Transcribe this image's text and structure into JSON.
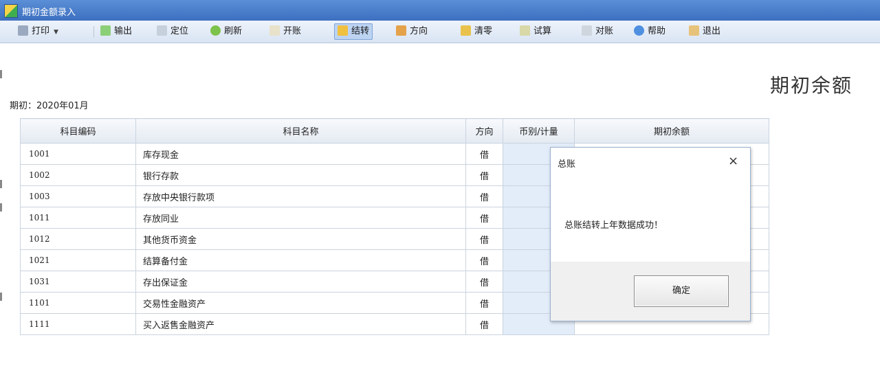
{
  "window": {
    "title": "期初金额录入"
  },
  "toolbar": {
    "print": "打印",
    "output": "输出",
    "locate": "定位",
    "refresh": "刷新",
    "open": "开账",
    "carry": "结转",
    "direction": "方向",
    "clear": "清零",
    "trial": "试算",
    "reconcile": "对账",
    "help": "帮助",
    "exit": "退出"
  },
  "page": {
    "title": "期初余额",
    "period_label": "期初：2020年01月"
  },
  "table": {
    "columns": [
      "科目编码",
      "科目名称",
      "方向",
      "币别/计量",
      "期初余额"
    ],
    "rows": [
      {
        "code": "1001",
        "name": "库存现金",
        "dir": "借"
      },
      {
        "code": "1002",
        "name": "银行存款",
        "dir": "借"
      },
      {
        "code": "1003",
        "name": "存放中央银行款项",
        "dir": "借"
      },
      {
        "code": "1011",
        "name": "存放同业",
        "dir": "借"
      },
      {
        "code": "1012",
        "name": "其他货币资金",
        "dir": "借"
      },
      {
        "code": "1021",
        "name": "结算备付金",
        "dir": "借"
      },
      {
        "code": "1031",
        "name": "存出保证金",
        "dir": "借"
      },
      {
        "code": "1101",
        "name": "交易性金融资产",
        "dir": "借"
      },
      {
        "code": "1111",
        "name": "买入返售金融资产",
        "dir": "借"
      }
    ]
  },
  "dialog": {
    "title": "总账",
    "message": "总账结转上年数据成功！",
    "ok_label": "确定"
  },
  "icons": {
    "close": "×",
    "dropdown": "▼"
  }
}
